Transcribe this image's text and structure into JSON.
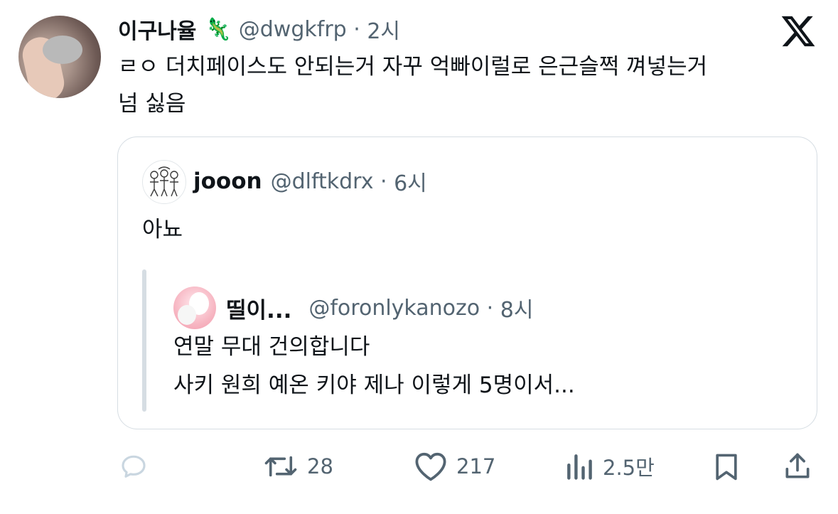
{
  "tweet": {
    "display_name": "이구나율",
    "name_emoji": "🦎",
    "handle": "@dwgkfrp",
    "time": "2시",
    "text_lines": [
      "ㄹㅇ 더치페이스도 안되는거 자꾸 억빠이럴로 은근슬쩍 껴넣는거",
      "넘 싫음"
    ]
  },
  "quote": {
    "display_name": "jooon",
    "handle": "@dlftkdrx",
    "time": "6시",
    "text": "아뇨"
  },
  "nested_quote": {
    "display_name": "띨이...",
    "handle": "@foronlykanozo",
    "time": "8시",
    "text_lines": [
      "연말 무대 건의합니다",
      "사키 원희 예온 키야 제나 이렇게 5명이서..."
    ]
  },
  "actions": {
    "reply_count": "",
    "retweet_count": "28",
    "like_count": "217",
    "views_count": "2.5만"
  },
  "icons": {
    "logo": "x-logo-icon",
    "reply": "reply-icon",
    "retweet": "retweet-icon",
    "like": "heart-icon",
    "views": "views-icon",
    "bookmark": "bookmark-icon",
    "share": "share-icon"
  },
  "colors": {
    "text_primary": "#0f1419",
    "text_secondary": "#536471",
    "border": "#d6dde3"
  }
}
